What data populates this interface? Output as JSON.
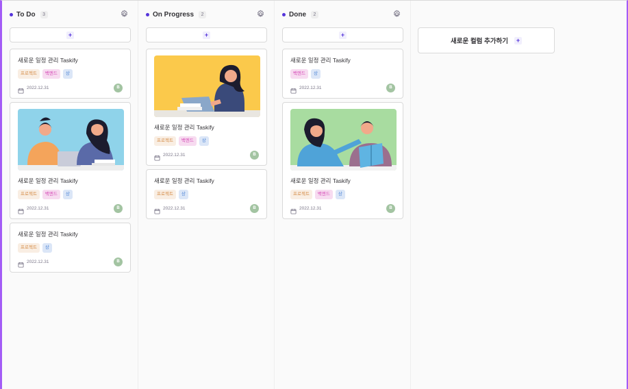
{
  "columns": [
    {
      "title": "To Do",
      "count": "3",
      "cards": [
        {
          "title": "새로운 일정 관리 Taskify",
          "has_image": false,
          "tags": [
            {
              "label": "프로젝트",
              "kind": "project"
            },
            {
              "label": "백엔드",
              "kind": "backend"
            },
            {
              "label": "상",
              "kind": "high"
            }
          ],
          "date": "2022.12.31",
          "avatar": "B"
        },
        {
          "title": "새로운 일정 관리 Taskify",
          "has_image": true,
          "image": "two-people-laptop-illustration",
          "image_bg": "#8fd3ea",
          "tags": [
            {
              "label": "프로젝트",
              "kind": "project"
            },
            {
              "label": "백엔드",
              "kind": "backend"
            },
            {
              "label": "상",
              "kind": "high"
            }
          ],
          "date": "2022.12.31",
          "avatar": "B"
        },
        {
          "title": "새로운 일정 관리 Taskify",
          "has_image": false,
          "tags": [
            {
              "label": "프로젝트",
              "kind": "project"
            },
            {
              "label": "상",
              "kind": "high"
            }
          ],
          "date": "2022.12.31",
          "avatar": "B"
        }
      ]
    },
    {
      "title": "On Progress",
      "count": "2",
      "cards": [
        {
          "title": "새로운 일정 관리 Taskify",
          "has_image": true,
          "image": "woman-laptop-illustration",
          "image_bg": "#fbc94b",
          "tags": [
            {
              "label": "프로젝트",
              "kind": "project"
            },
            {
              "label": "백엔드",
              "kind": "backend"
            },
            {
              "label": "상",
              "kind": "high"
            }
          ],
          "date": "2022.12.31",
          "avatar": "B"
        },
        {
          "title": "새로운 일정 관리 Taskify",
          "has_image": false,
          "tags": [
            {
              "label": "프로젝트",
              "kind": "project"
            },
            {
              "label": "상",
              "kind": "high"
            }
          ],
          "date": "2022.12.31",
          "avatar": "B"
        }
      ]
    },
    {
      "title": "Done",
      "count": "2",
      "cards": [
        {
          "title": "새로운 일정 관리 Taskify",
          "has_image": false,
          "tags": [
            {
              "label": "백엔드",
              "kind": "backend"
            },
            {
              "label": "상",
              "kind": "high"
            }
          ],
          "date": "2022.12.31",
          "avatar": "B"
        },
        {
          "title": "새로운 일정 관리 Taskify",
          "has_image": true,
          "image": "two-people-reading-illustration",
          "image_bg": "#a8dca0",
          "tags": [
            {
              "label": "프로젝트",
              "kind": "project"
            },
            {
              "label": "백엔드",
              "kind": "backend"
            },
            {
              "label": "상",
              "kind": "high"
            }
          ],
          "date": "2022.12.31",
          "avatar": "B"
        }
      ]
    }
  ],
  "add_card_symbol": "+",
  "new_column": {
    "label": "새로운 컬럼 추가하기",
    "symbol": "+"
  },
  "icons": {
    "settings": "gear-icon",
    "calendar": "calendar-icon",
    "add": "plus-icon"
  },
  "colors": {
    "accent": "#5534da",
    "frame_border": "#a35cf6",
    "avatar": "#a3c4a2"
  }
}
